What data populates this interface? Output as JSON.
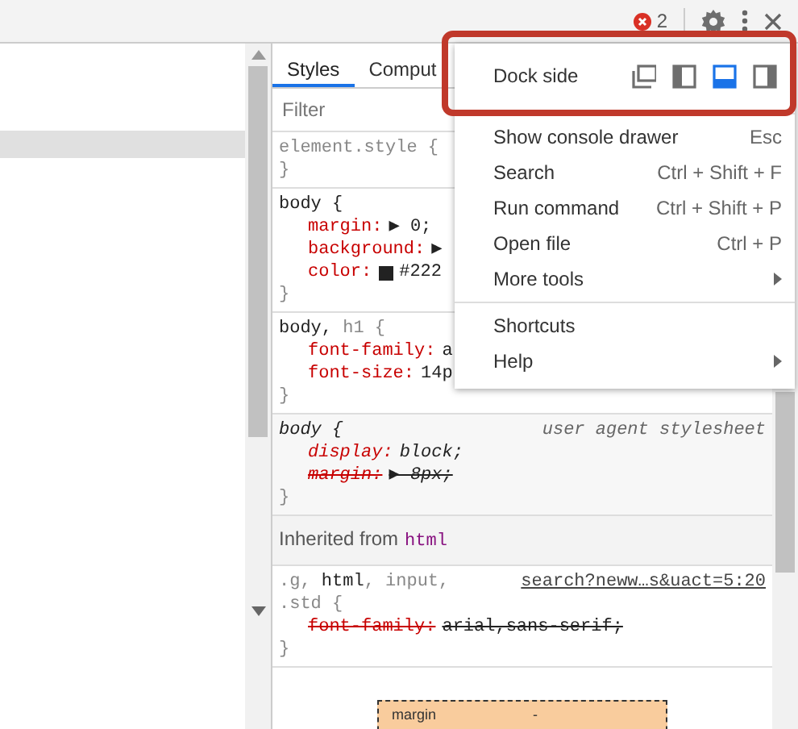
{
  "toolbar": {
    "error_count": "2"
  },
  "styles_panel": {
    "tabs": [
      {
        "label": "Styles",
        "selected": true
      },
      {
        "label": "Comput",
        "selected": false
      }
    ],
    "filter": {
      "placeholder": "Filter"
    },
    "rules": [
      {
        "selector": [
          {
            "text": "element.style {",
            "matched": false
          }
        ],
        "italic": false,
        "close": "}"
      },
      {
        "selector": [
          {
            "text": "body {",
            "matched": true
          }
        ],
        "italic": false,
        "declarations": [
          {
            "name": "margin:",
            "value": "▶ 0;",
            "overridden": false
          },
          {
            "name": "background:",
            "value": "▶",
            "overridden": false
          },
          {
            "name": "color:",
            "value": "#222",
            "color": "#222222",
            "overridden": false
          }
        ],
        "close": "}"
      },
      {
        "selector": [
          {
            "text": "body,",
            "matched": true
          },
          {
            "text": " h1 {",
            "matched": false
          }
        ],
        "italic": false,
        "declarations": [
          {
            "name": "font-family:",
            "value": "a",
            "overridden": false
          },
          {
            "name": "font-size:",
            "value": "14p",
            "overridden": false
          }
        ],
        "close": "}"
      },
      {
        "selector": [
          {
            "text": "body {",
            "matched": true
          }
        ],
        "source": "user agent stylesheet",
        "source_link": false,
        "italic": true,
        "declarations": [
          {
            "name": "display:",
            "value": "block;",
            "overridden": false
          },
          {
            "name": "margin:",
            "value": "▶ 8px;",
            "overridden": true
          }
        ],
        "close": "}"
      },
      {
        "inherited_label": "Inherited from",
        "inherited_tag": "html"
      },
      {
        "selector": [
          {
            "text": ".g, ",
            "matched": false
          },
          {
            "text": "html",
            "matched": true
          },
          {
            "text": ", input,",
            "matched": false
          }
        ],
        "selector_line2": ".std {",
        "source": "search?neww…s&uact=5:20",
        "source_link": true,
        "italic": false,
        "declarations": [
          {
            "name": "font-family:",
            "value": "arial,sans-serif;",
            "overridden": true
          }
        ],
        "close": "}"
      }
    ],
    "box_model": {
      "label": "margin",
      "value": "-"
    }
  },
  "menu": {
    "dock_side": {
      "label": "Dock side",
      "options": [
        {
          "kind": "undock",
          "selected": false
        },
        {
          "kind": "left",
          "selected": false
        },
        {
          "kind": "bottom",
          "selected": true
        },
        {
          "kind": "right",
          "selected": false
        }
      ]
    },
    "groups": [
      [
        {
          "label": "Show console drawer",
          "shortcut": "Esc",
          "submenu": false
        },
        {
          "label": "Search",
          "shortcut": "Ctrl + Shift + F",
          "submenu": false
        },
        {
          "label": "Run command",
          "shortcut": "Ctrl + Shift + P",
          "submenu": false
        },
        {
          "label": "Open file",
          "shortcut": "Ctrl + P",
          "submenu": false
        },
        {
          "label": "More tools",
          "submenu": true
        }
      ],
      [
        {
          "label": "Shortcuts",
          "submenu": false
        },
        {
          "label": "Help",
          "submenu": true
        }
      ]
    ],
    "highlighted_section": true
  }
}
